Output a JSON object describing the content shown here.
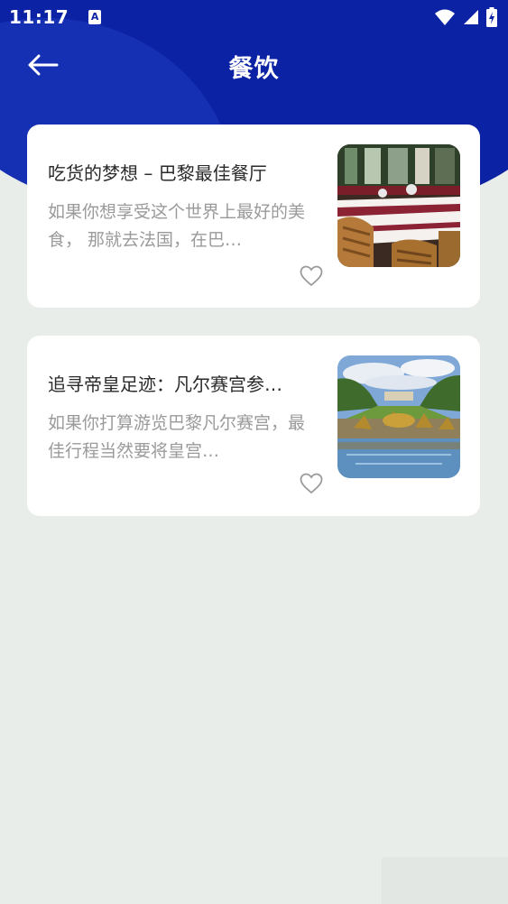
{
  "status_bar": {
    "time": "11:17",
    "notification_letter": "A"
  },
  "header": {
    "title": "餐饮"
  },
  "articles": [
    {
      "title": "吃货的梦想 – 巴黎最佳餐厅",
      "description": "如果你想享受这个世界上最好的美食， 那就去法国，在巴…",
      "image": "restaurant-terrace-photo"
    },
    {
      "title": "追寻帝皇足迹：凡尔赛宫参…",
      "description": "如果你打算游览巴黎凡尔赛宫，最佳行程当然要将皇宫…",
      "image": "versailles-fountain-photo"
    }
  ],
  "colors": {
    "header_blue": "#0c22a4",
    "background": "#e9edea"
  }
}
